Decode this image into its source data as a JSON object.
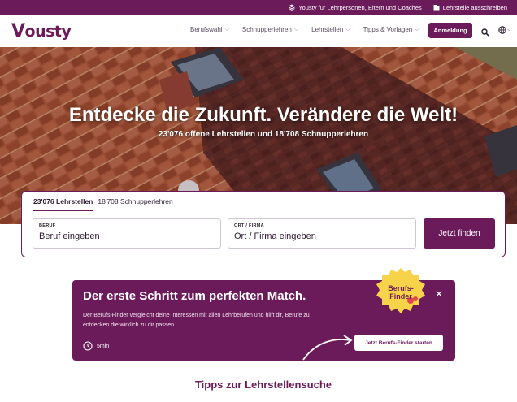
{
  "topbar": {
    "audience_link": "Yousty für Lehrpersonen, Eltern und Coaches",
    "post_link": "Lehrstelle ausschreiben"
  },
  "header": {
    "logo": "ousty",
    "nav": [
      "Berufswahl",
      "Schnupperlehren",
      "Lehrstellen",
      "Tipps & Vorlagen"
    ],
    "login_label": "Anmeldung"
  },
  "hero": {
    "title": "Entdecke die Zukunft. Verändere die Welt!",
    "subtitle": "23'076 offene Lehrstellen und 18'708 Schnupperlehren"
  },
  "search": {
    "tabs": [
      "23'076 Lehrstellen",
      "18'708 Schnupperlehren"
    ],
    "active_tab": 0,
    "beruf_label": "BERUF",
    "beruf_placeholder": "Beruf eingeben",
    "ort_label": "ORT / FIRMA",
    "ort_placeholder": "Ort / Firma eingeben",
    "submit_label": "Jetzt finden"
  },
  "promo": {
    "title": "Der erste Schritt zum perfekten Match.",
    "text": "Der Berufs-Finder vergleicht deine Interessen mit allen Lehrberufen und hilft dir, Berufe zu entdecken die wirklich zu dir passen.",
    "duration": "5min",
    "cta_label": "Jetzt Berufs-Finder starten",
    "badge_line1": "Berufs-",
    "badge_line2": "Finder"
  },
  "section": {
    "title": "Tipps zur Lehrstellensuche"
  },
  "colors": {
    "brand": "#6b1b5a",
    "badge_yellow": "#f7d34a"
  }
}
